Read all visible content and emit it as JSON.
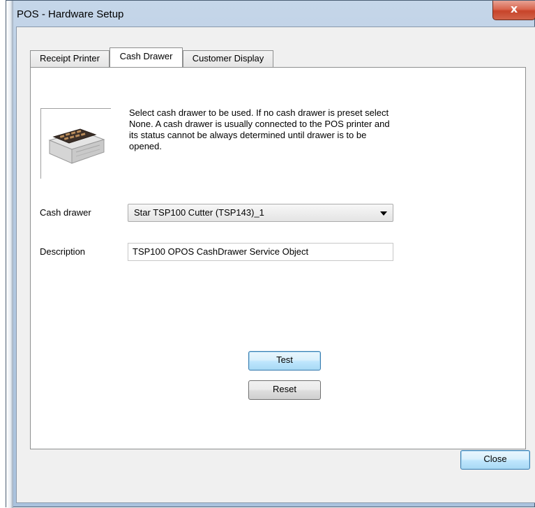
{
  "window": {
    "title": "POS - Hardware Setup",
    "close_glyph": "x"
  },
  "tabs": [
    {
      "label": "Receipt Printer",
      "active": false
    },
    {
      "label": "Cash Drawer",
      "active": true
    },
    {
      "label": "Customer Display",
      "active": false
    }
  ],
  "cash_drawer_tab": {
    "image_icon": "cash-drawer-image",
    "description_text": "Select cash drawer to be used. If no cash drawer is preset select None. A cash drawer is usually connected to the POS printer and its status cannot be always determined until drawer is to be opened.",
    "cash_drawer_label": "Cash drawer",
    "cash_drawer_value": "Star TSP100 Cutter (TSP143)_1",
    "description_label": "Description",
    "description_value": "TSP100 OPOS CashDrawer Service Object",
    "test_button": "Test",
    "reset_button": "Reset"
  },
  "footer": {
    "close_button": "Close"
  },
  "colors": {
    "title_bar": "#b6cbe2",
    "close_button": "#c7442a",
    "focused_button": "#3c7fb1"
  }
}
